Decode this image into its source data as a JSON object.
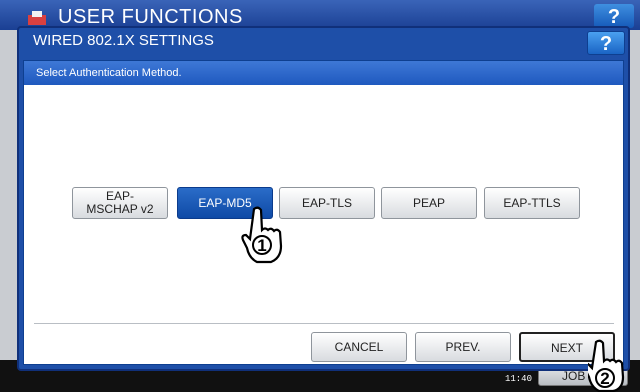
{
  "background": {
    "title": "USER FUNCTIONS",
    "help_label": "?",
    "clock": "11:40",
    "job_status_label": "JOB ST"
  },
  "dialog": {
    "title": "WIRED 802.1X SETTINGS",
    "help_label": "?",
    "prompt": "Select Authentication Method.",
    "methods": [
      {
        "label": "EAP-MSCHAP v2",
        "selected": false
      },
      {
        "label": "EAP-MD5",
        "selected": true
      },
      {
        "label": "EAP-TLS",
        "selected": false
      },
      {
        "label": "PEAP",
        "selected": false
      },
      {
        "label": "EAP-TTLS",
        "selected": false
      }
    ],
    "cancel_label": "CANCEL",
    "prev_label": "PREV.",
    "next_label": "NEXT"
  },
  "callouts": [
    {
      "step": "1",
      "icon": "pointing-hand-icon"
    },
    {
      "step": "2",
      "icon": "pointing-hand-icon"
    }
  ],
  "colors": {
    "dialog_blue": "#1e4fa8",
    "selected_button": "#1a5bb8"
  }
}
